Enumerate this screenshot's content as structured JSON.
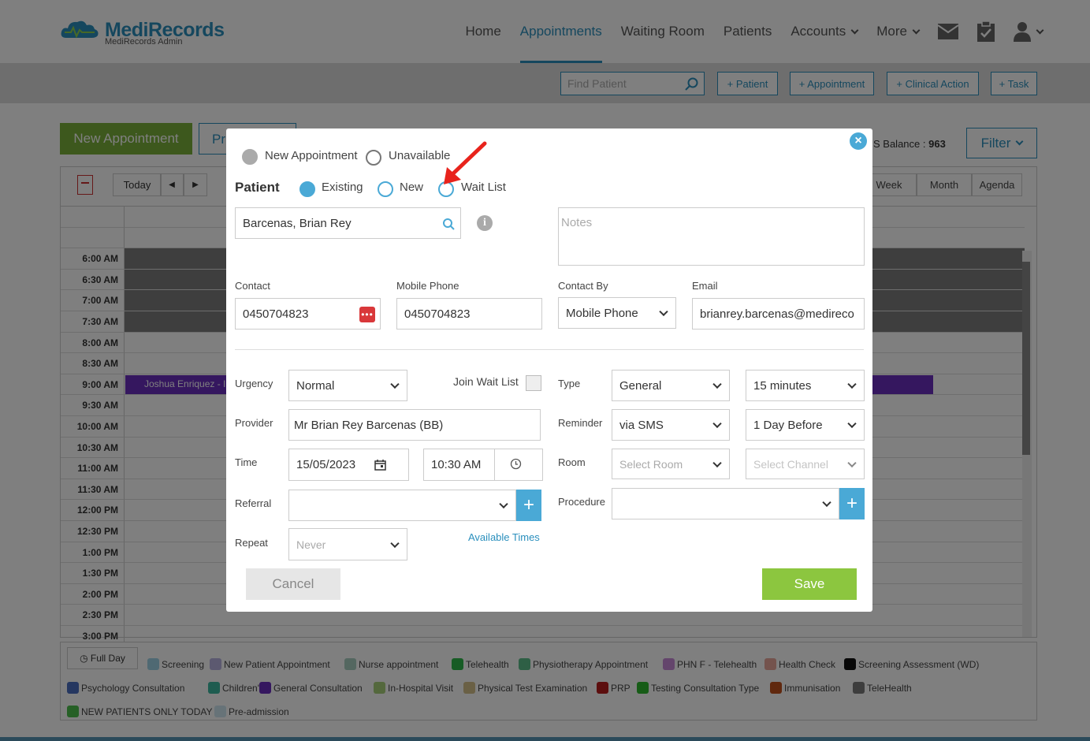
{
  "app": {
    "logo_name": "MediRecords",
    "logo_sub": "MediRecords Admin"
  },
  "nav": {
    "items": [
      "Home",
      "Appointments",
      "Waiting Room",
      "Patients",
      "Accounts",
      "More"
    ],
    "active": "Appointments"
  },
  "toolbar": {
    "find_patient_placeholder": "Find Patient",
    "buttons": [
      "+ Patient",
      "+ Appointment",
      "+ Clinical Action",
      "+ Task"
    ]
  },
  "page": {
    "new_appointment": "New Appointment",
    "pr_button": "Pr",
    "balance_label": "S Balance :",
    "balance_value": "963",
    "filter": "Filter"
  },
  "calendar": {
    "today": "Today",
    "views": [
      "Week",
      "Month",
      "Agenda"
    ],
    "times": [
      "6:00 AM",
      "6:30 AM",
      "7:00 AM",
      "7:30 AM",
      "8:00 AM",
      "8:30 AM",
      "9:00 AM",
      "9:30 AM",
      "10:00 AM",
      "10:30 AM",
      "11:00 AM",
      "11:30 AM",
      "12:00 PM",
      "12:30 PM",
      "1:00 PM",
      "1:30 PM",
      "2:00 PM",
      "2:30 PM",
      "3:00 PM"
    ],
    "appointment_text": "Joshua Enriquez - I"
  },
  "legend": {
    "full_day": "Full Day",
    "items": [
      {
        "label": "Screening",
        "color": "#9fd3e6"
      },
      {
        "label": "New Patient Appointment",
        "color": "#b9b3e0"
      },
      {
        "label": "Nurse appointment",
        "color": "#a8cfc0"
      },
      {
        "label": "Telehealth",
        "color": "#2eb84a"
      },
      {
        "label": "Physiotherapy Appointment",
        "color": "#5cbf8a"
      },
      {
        "label": "PHN F - Telehealth",
        "color": "#c88ad8"
      },
      {
        "label": "Health Check",
        "color": "#e8a79a"
      },
      {
        "label": "Screening Assessment (WD)",
        "color": "#111111"
      },
      {
        "label": "Psychology Consultation",
        "color": "#4a6fc0"
      },
      {
        "label": "Children's",
        "color": "#3cb8a0"
      },
      {
        "label": "General Consultation",
        "color": "#6a2fbf"
      },
      {
        "label": "In-Hospital Visit",
        "color": "#a9d07a"
      },
      {
        "label": "Physical Test Examination",
        "color": "#d4c08a"
      },
      {
        "label": "PRP",
        "color": "#b81c1c"
      },
      {
        "label": "Testing Consultation Type",
        "color": "#2eb82e"
      },
      {
        "label": "Immunisation",
        "color": "#c0501c"
      },
      {
        "label": "TeleHealth",
        "color": "#7a7a7a"
      },
      {
        "label": "NEW PATIENTS ONLY TODAY",
        "color": "#4cc04c"
      },
      {
        "label": "Pre-admission",
        "color": "#cfe6f0"
      }
    ]
  },
  "modal": {
    "type_options": [
      "New Appointment",
      "Unavailable"
    ],
    "patient_label": "Patient",
    "patient_options": [
      "Existing",
      "New",
      "Wait List"
    ],
    "patient_value": "Barcenas, Brian Rey",
    "notes_placeholder": "Notes",
    "contact_label": "Contact",
    "contact_value": "0450704823",
    "mobile_label": "Mobile Phone",
    "mobile_value": "0450704823",
    "contact_by_label": "Contact By",
    "contact_by_value": "Mobile Phone",
    "email_label": "Email",
    "email_value": "brianrey.barcenas@medireco",
    "urgency_label": "Urgency",
    "urgency_value": "Normal",
    "join_wait_list_label": "Join Wait List",
    "type_label": "Type",
    "type_value": "General",
    "duration_value": "15 minutes",
    "provider_label": "Provider",
    "provider_value": "Mr Brian Rey Barcenas (BB)",
    "reminder_label": "Reminder",
    "reminder_value": "via SMS",
    "reminder_when_value": "1 Day Before",
    "time_label": "Time",
    "date_value": "15/05/2023",
    "time_value": "10:30 AM",
    "room_label": "Room",
    "room_placeholder": "Select Room",
    "channel_placeholder": "Select Channel",
    "referral_label": "Referral",
    "procedure_label": "Procedure",
    "repeat_label": "Repeat",
    "repeat_value": "Never",
    "available_times": "Available Times",
    "cancel": "Cancel",
    "save": "Save"
  }
}
